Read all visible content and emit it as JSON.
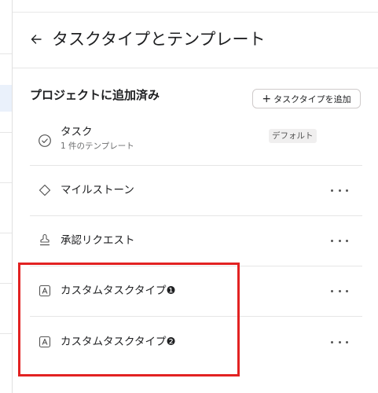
{
  "header": {
    "title": "タスクタイプとテンプレート"
  },
  "section": {
    "title": "プロジェクトに追加済み",
    "add_button": "タスクタイプを追加"
  },
  "items": [
    {
      "name": "タスク",
      "subtitle": "1 件のテンプレート",
      "badge": "デフォルト",
      "icon": "check-circle-icon"
    },
    {
      "name": "マイルストーン",
      "icon": "diamond-icon"
    },
    {
      "name": "承認リクエスト",
      "icon": "stamp-icon"
    },
    {
      "name": "カスタムタスクタイプ❶",
      "icon": "letter-a-icon"
    },
    {
      "name": "カスタムタスクタイプ❷",
      "icon": "letter-a-icon"
    }
  ],
  "colors": {
    "highlight": "#e22222",
    "text": "#1e1f21",
    "muted": "#6d6e6f"
  }
}
